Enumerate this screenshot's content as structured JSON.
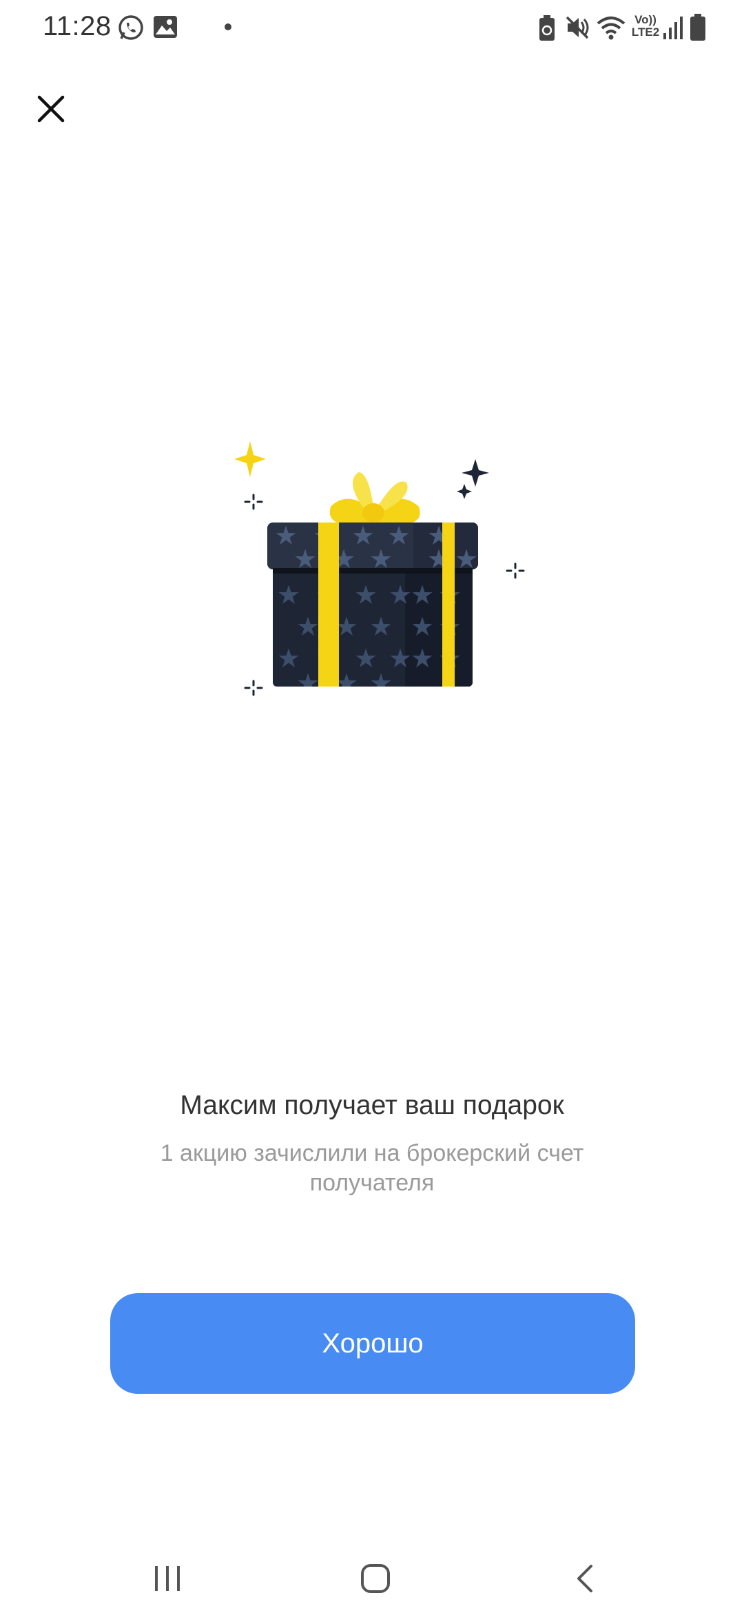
{
  "status_bar": {
    "time": "11:28",
    "network_label_top": "Vo))",
    "network_label_bottom": "LTE2",
    "icons": [
      "whatsapp-icon",
      "image-icon",
      "battery-saver-icon",
      "mute-icon",
      "wifi-icon",
      "signal-icon",
      "battery-icon"
    ]
  },
  "dialog": {
    "close_icon": "close-icon",
    "illustration": "gift-box",
    "title": "Максим получает ваш подарок",
    "subtitle": "1 акцию зачислили на брокерский счет получателя",
    "button_label": "Хорошо"
  },
  "colors": {
    "accent": "#478bf3",
    "gift_box": "#1e2535",
    "ribbon": "#f5d415",
    "stars": "#3d4e6a"
  },
  "nav_bar": {
    "icons": [
      "recent-apps-icon",
      "home-icon",
      "back-icon"
    ]
  }
}
